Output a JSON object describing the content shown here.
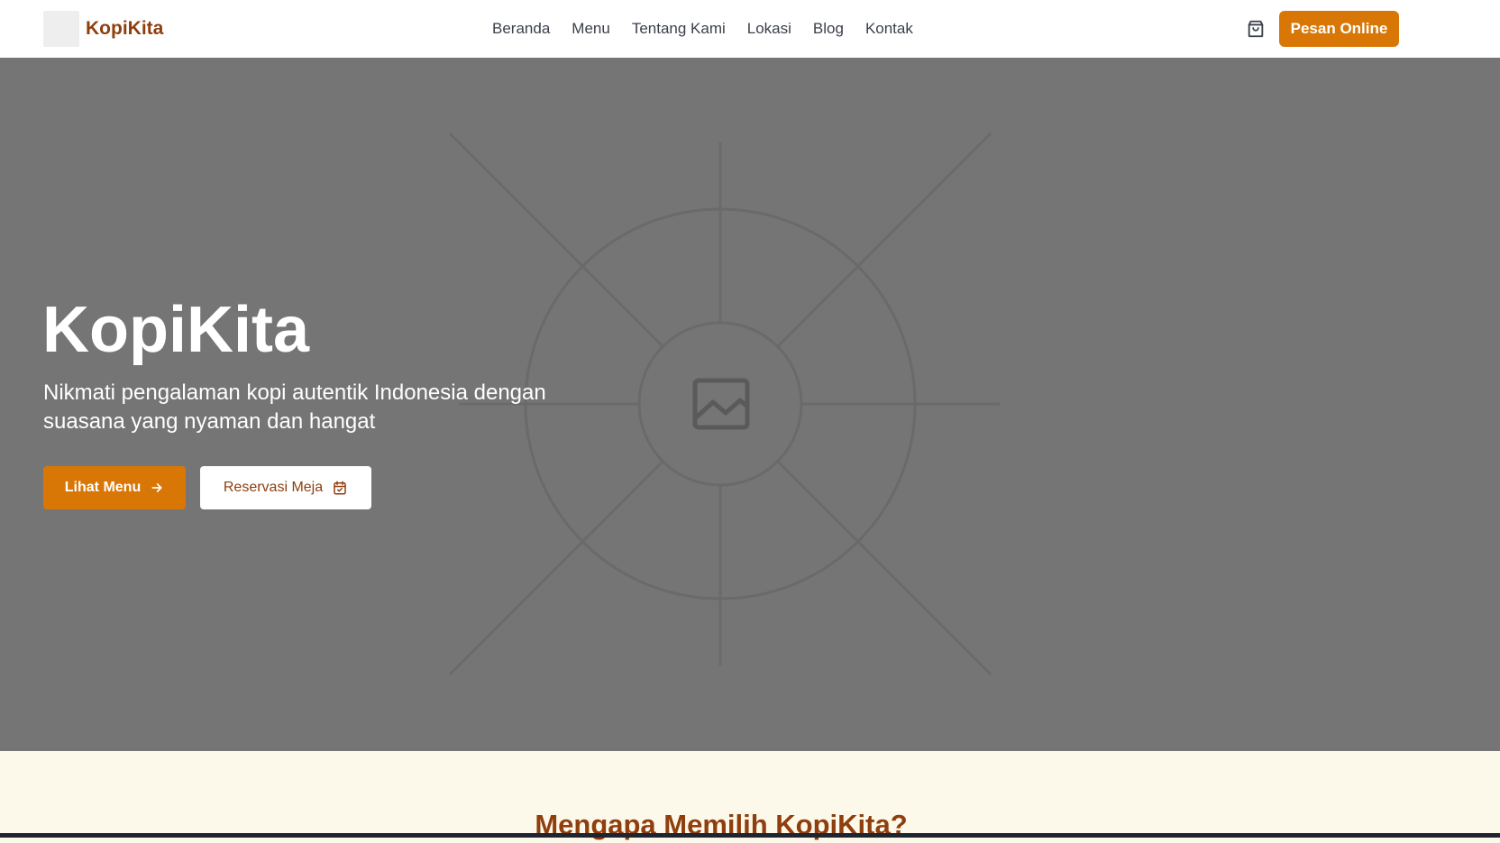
{
  "brand": {
    "name": "KopiKita"
  },
  "nav": {
    "items": [
      "Beranda",
      "Menu",
      "Tentang Kami",
      "Lokasi",
      "Blog",
      "Kontak"
    ]
  },
  "header": {
    "cart_icon": "shopping-bag-icon",
    "order_button": "Pesan Online"
  },
  "hero": {
    "title": "KopiKita",
    "subtitle": "Nikmati pengalaman kopi autentik Indonesia dengan suasana yang nyaman dan hangat",
    "primary_button": "Lihat Menu",
    "primary_icon": "arrow-right-icon",
    "secondary_button": "Reservasi Meja",
    "secondary_icon": "calendar-check-icon",
    "background_icon": "image-placeholder-icon"
  },
  "features": {
    "title": "Mengapa Memilih KopiKita?"
  },
  "colors": {
    "accent": "#d97706",
    "brand": "#8f3e0e",
    "hero_bg": "#757575",
    "section_bg": "#fdf9ea"
  }
}
